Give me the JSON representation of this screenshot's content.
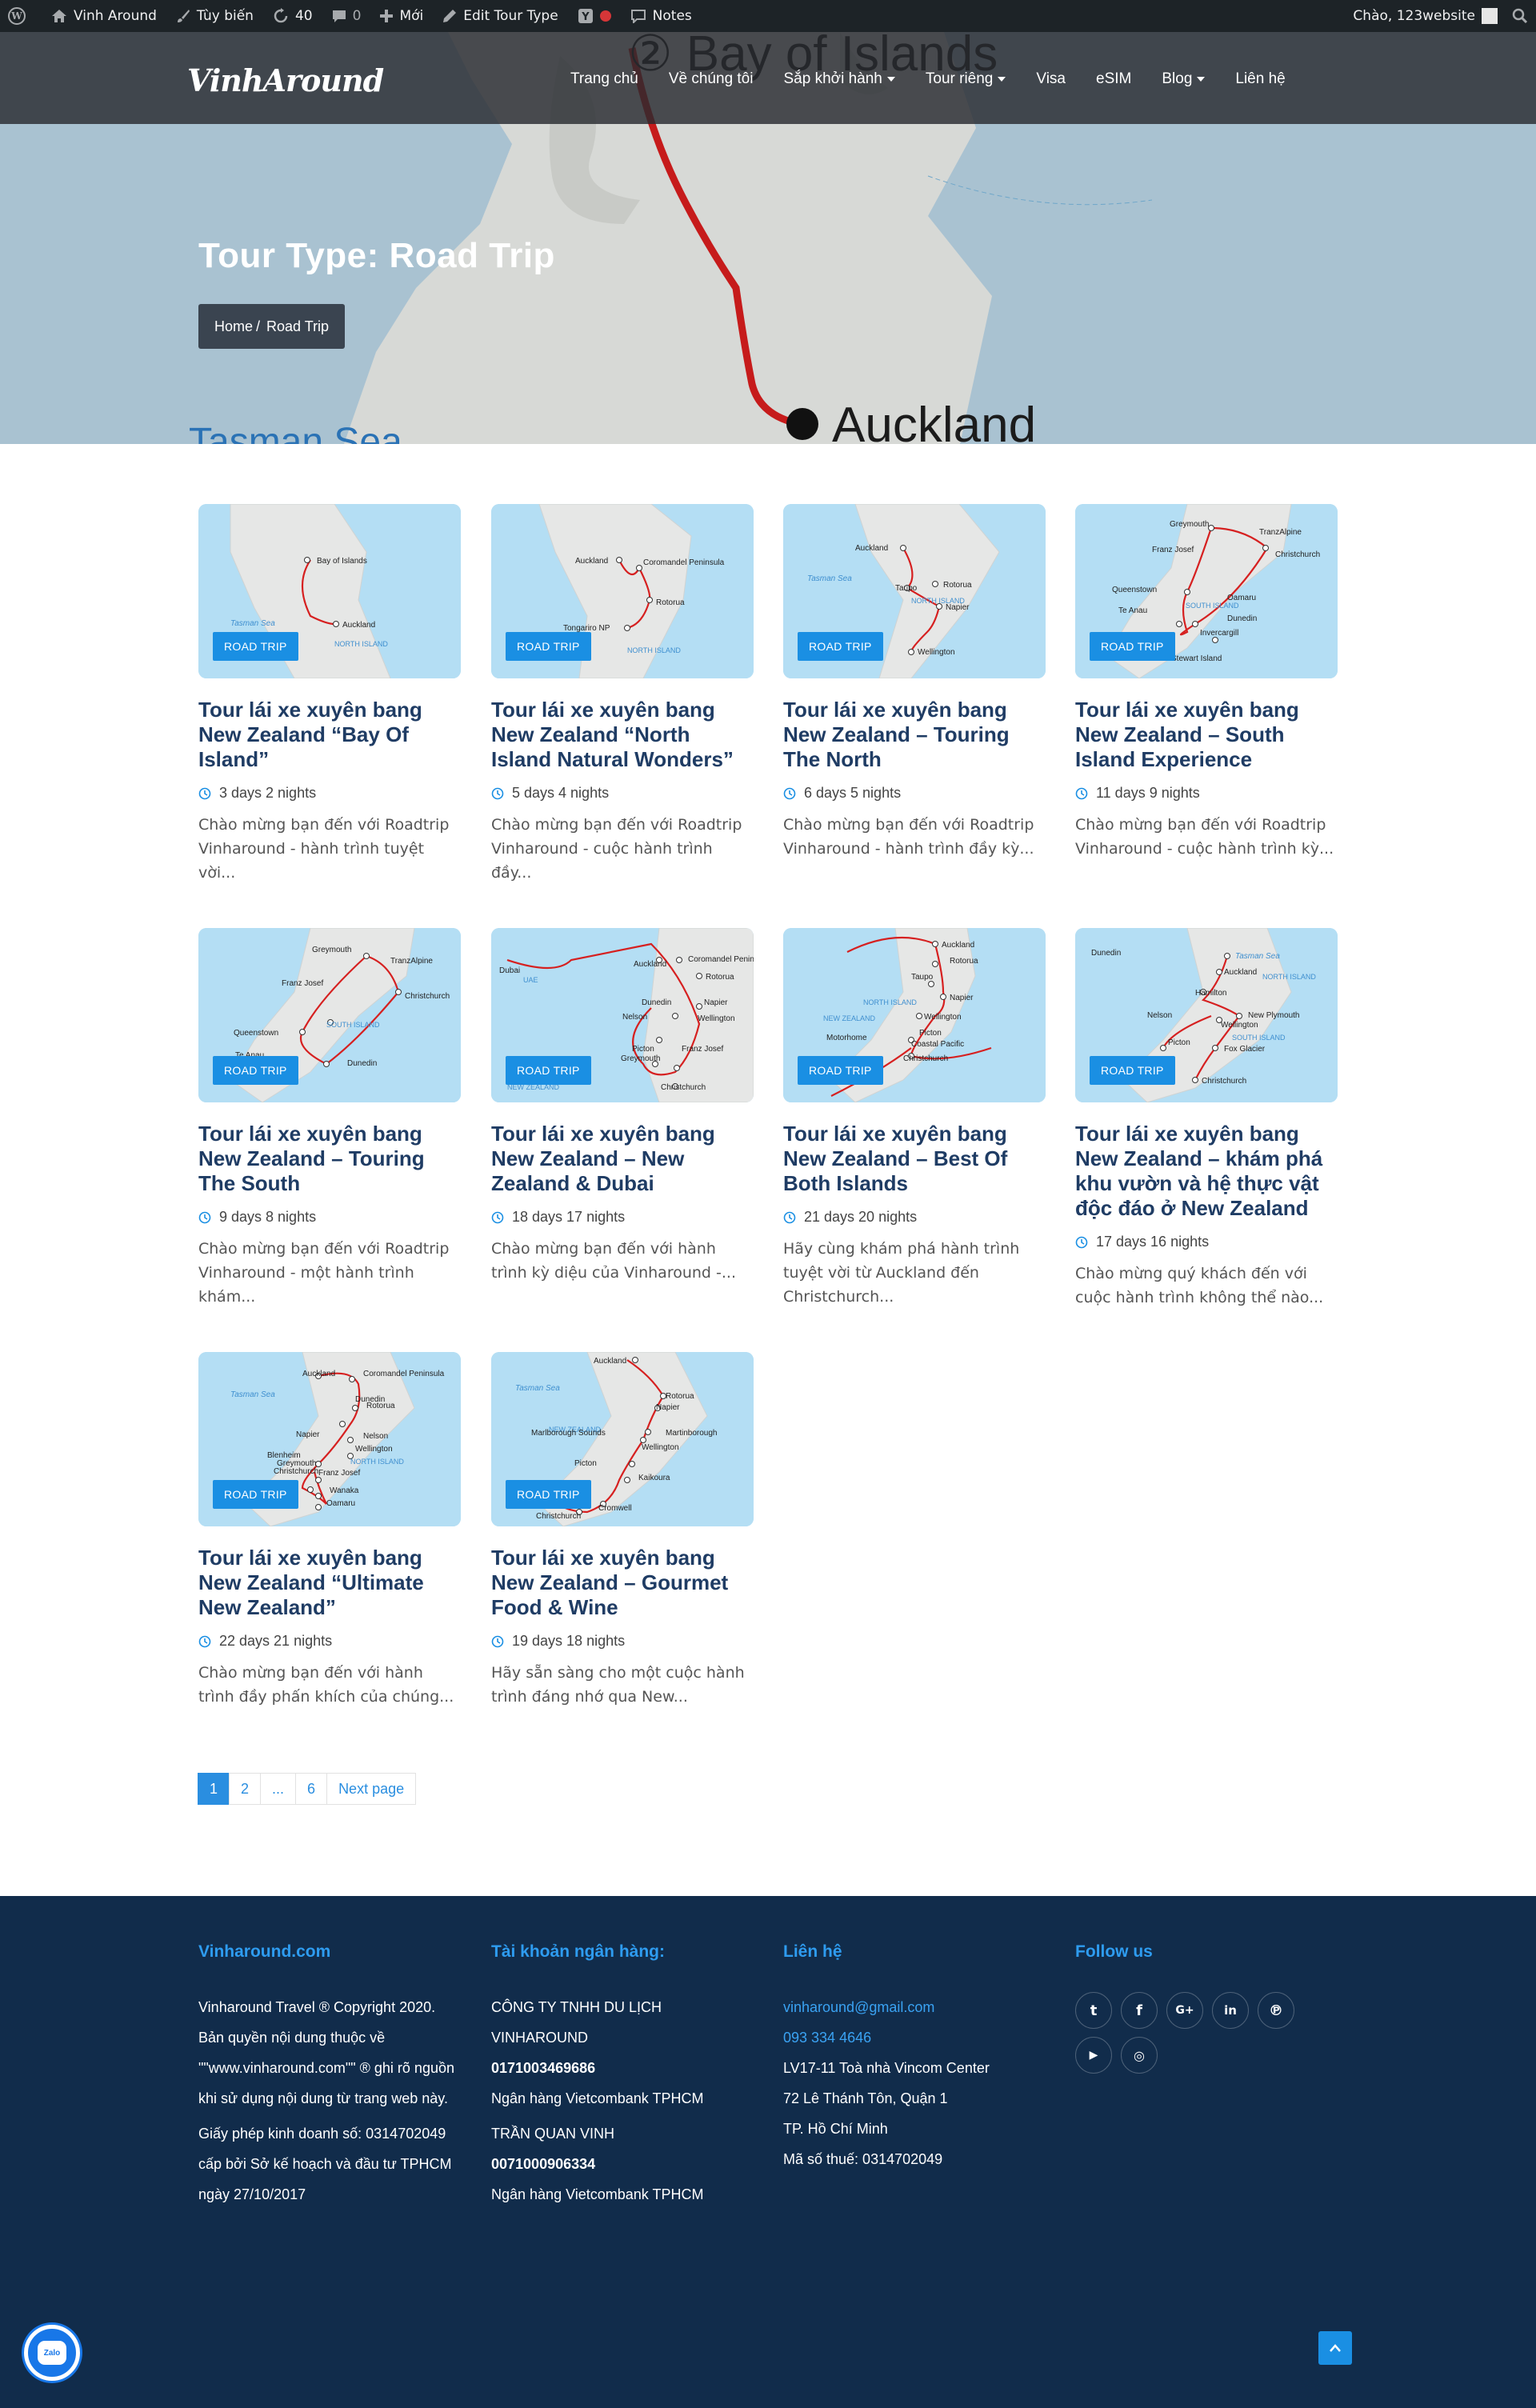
{
  "admin_bar": {
    "site_name": "Vinh Around",
    "customize": "Tùy biến",
    "updates_count": "40",
    "comments_count": "0",
    "new_label": "Mới",
    "edit_label": "Edit Tour Type",
    "notes_label": "Notes",
    "greeting": "Chào, 123website",
    "icons": [
      "wordpress-icon",
      "home-icon",
      "brush-icon",
      "refresh-icon",
      "comment-icon",
      "plus-icon",
      "pencil-icon",
      "yoast-icon",
      "notes-icon",
      "avatar",
      "search-icon"
    ]
  },
  "header": {
    "logo": "VinhAround",
    "nav": [
      {
        "label": "Trang chủ",
        "dropdown": false
      },
      {
        "label": "Về chúng tôi",
        "dropdown": false
      },
      {
        "label": "Sắp khởi hành",
        "dropdown": true
      },
      {
        "label": "Tour riêng",
        "dropdown": true
      },
      {
        "label": "Visa",
        "dropdown": false
      },
      {
        "label": "eSIM",
        "dropdown": false
      },
      {
        "label": "Blog",
        "dropdown": true
      },
      {
        "label": "Liên hệ",
        "dropdown": false
      }
    ]
  },
  "hero": {
    "title": "Tour Type: Road Trip",
    "breadcrumb_home": "Home",
    "breadcrumb_sep": "/",
    "breadcrumb_current": "Road Trip",
    "map_labels": [
      "Bay of Islands",
      "Auckland",
      "Tasman Sea"
    ]
  },
  "badge_label": "ROAD TRIP",
  "tours": [
    {
      "title": "Tour lái xe xuyên bang New Zealand “Bay Of Island”",
      "duration": "3 days 2 nights",
      "excerpt": "Chào mừng bạn đến với Roadtrip Vinharound - hành trình tuyệt vời...",
      "map_labels": [
        "Bay of Islands",
        "Auckland",
        "Tasman Sea",
        "NORTH ISLAND"
      ]
    },
    {
      "title": "Tour lái xe xuyên bang New Zealand “North Island Natural Wonders”",
      "duration": "5 days 4 nights",
      "excerpt": "Chào mừng bạn đến với Roadtrip Vinharound - cuộc hành trình đầy...",
      "map_labels": [
        "Auckland",
        "Coromandel Peninsula",
        "Rotorua",
        "Tongariro NP",
        "NORTH ISLAND"
      ]
    },
    {
      "title": "Tour lái xe xuyên bang New Zealand – Touring The North",
      "duration": "6 days 5 nights",
      "excerpt": "Chào mừng bạn đến với Roadtrip Vinharound - hành trình đầy kỳ...",
      "map_labels": [
        "Auckland",
        "Taupo",
        "Rotorua",
        "Napier",
        "Wellington",
        "Tasman Sea",
        "NORTH ISLAND"
      ]
    },
    {
      "title": "Tour lái xe xuyên bang New Zealand – South Island Experience",
      "duration": "11 days 9 nights",
      "excerpt": "Chào mừng bạn đến với Roadtrip Vinharound - cuộc hành trình kỳ...",
      "map_labels": [
        "Greymouth",
        "TranzAlpine",
        "Franz Josef",
        "Christchurch",
        "Queenstown",
        "Oamaru",
        "Te Anau",
        "Dunedin",
        "Invercargill",
        "Stewart Island",
        "SOUTH ISLAND"
      ]
    },
    {
      "title": "Tour lái xe xuyên bang New Zealand – Touring The South",
      "duration": "9 days 8 nights",
      "excerpt": "Chào mừng bạn đến với Roadtrip Vinharound - một hành trình khám...",
      "map_labels": [
        "Greymouth",
        "TranzAlpine",
        "Franz Josef",
        "Christchurch",
        "Queenstown",
        "Te Anau",
        "Dunedin",
        "SOUTH ISLAND"
      ]
    },
    {
      "title": "Tour lái xe xuyên bang New Zealand – New Zealand & Dubai",
      "duration": "18 days 17 nights",
      "excerpt": "Chào mừng bạn đến với hành trình kỳ diệu của Vinharound -...",
      "map_labels": [
        "Dubai",
        "UAE",
        "Auckland",
        "Coromandel Peninsula",
        "Rotorua",
        "Napier",
        "Wellington",
        "Nelson",
        "Picton",
        "Greymouth",
        "Franz Josef",
        "Christchurch",
        "Dunedin",
        "NEW ZEALAND"
      ]
    },
    {
      "title": "Tour lái xe xuyên bang New Zealand – Best Of Both Islands",
      "duration": "21 days 20 nights",
      "excerpt": "Hãy cùng khám phá hành trình tuyệt vời từ Auckland đến Christchurch...",
      "map_labels": [
        "Auckland",
        "Rotorua",
        "Taupo",
        "Napier",
        "Wellington",
        "Picton",
        "Coastal Pacific",
        "Christchurch",
        "Motorhome",
        "NORTH ISLAND",
        "NEW ZEALAND"
      ]
    },
    {
      "title": "Tour lái xe xuyên bang New Zealand – khám phá khu vườn và hệ thực vật độc đáo ở New Zealand",
      "duration": "17 days 16 nights",
      "excerpt": "Chào mừng quý khách đến với cuộc hành trình không thể nào...",
      "map_labels": [
        "Tasman Sea",
        "Auckland",
        "Hamilton",
        "New Plymouth",
        "Nelson",
        "Wellington",
        "Picton",
        "Fox Glacier",
        "Christchurch",
        "Dunedin",
        "NORTH ISLAND",
        "SOUTH ISLAND"
      ]
    },
    {
      "title": "Tour lái xe xuyên bang New Zealand “Ultimate New Zealand”",
      "duration": "22 days 21 nights",
      "excerpt": "Chào mừng bạn đến với hành trình đầy phấn khích của chúng...",
      "map_labels": [
        "Auckland",
        "Coromandel Peninsula",
        "Tasman Sea",
        "Rotorua",
        "Napier",
        "Nelson",
        "Wellington",
        "Blenheim",
        "Greymouth",
        "Franz Josef",
        "Christchurch",
        "Wanaka",
        "Oamaru",
        "Dunedin",
        "NORTH ISLAND",
        "SOUTH ISLAND"
      ]
    },
    {
      "title": "Tour lái xe xuyên bang New Zealand – Gourmet Food & Wine",
      "duration": "19 days 18 nights",
      "excerpt": "Hãy sẵn sàng cho một cuộc hành trình đáng nhớ qua New...",
      "map_labels": [
        "Auckland",
        "Tasman Sea",
        "Rotorua",
        "Napier",
        "NEW ZEALAND",
        "Martinborough",
        "Marlborough Sounds",
        "Wellington",
        "Picton",
        "Kaikoura",
        "Christchurch",
        "Cromwell",
        "Oamaru"
      ]
    }
  ],
  "pagination": {
    "pages": [
      "1",
      "2",
      "...",
      "6"
    ],
    "current": "1",
    "next_label": "Next page"
  },
  "footer": {
    "col1": {
      "heading": "Vinharound.com",
      "text1": "Vinharound Travel ® Copyright 2020. Bản quyền nội dung thuộc về \"\"www.vinharound.com\"\" ® ghi rõ nguồn khi sử dụng nội dung từ trang web này.",
      "text2": "Giấy phép kinh doanh số: 0314702049 cấp bởi Sở kế hoạch và đầu tư TPHCM ngày 27/10/2017"
    },
    "col2": {
      "heading": "Tài khoản ngân hàng:",
      "company": "CÔNG TY TNHH DU LỊCH VINHAROUND",
      "account1": "0171003469686",
      "bank1": "Ngân hàng Vietcombank TPHCM",
      "person": "TRẦN QUAN VINH",
      "account2": "0071000906334",
      "bank2": "Ngân hàng Vietcombank TPHCM"
    },
    "col3": {
      "heading": "Liên hệ",
      "email": "vinharound@gmail.com",
      "phone": "093 334 4646",
      "address1": "LV17-11 Toà nhà Vincom Center",
      "address2": "72 Lê Thánh Tôn, Quận 1",
      "address3": "TP. Hồ Chí Minh",
      "tax": "Mã số thuế: 0314702049"
    },
    "col4": {
      "heading": "Follow us",
      "social": [
        "twitter-icon",
        "facebook-icon",
        "google-plus-icon",
        "linkedin-icon",
        "pinterest-icon",
        "youtube-icon",
        "instagram-icon"
      ]
    }
  },
  "zalo_label": "Zalo",
  "colors": {
    "accent": "#1a8fe3",
    "title": "#1f3c64",
    "footer_bg": "#112c4b",
    "footer_heading": "#2e9cf0",
    "map_sea": "#b4def4",
    "route": "#d62020"
  }
}
